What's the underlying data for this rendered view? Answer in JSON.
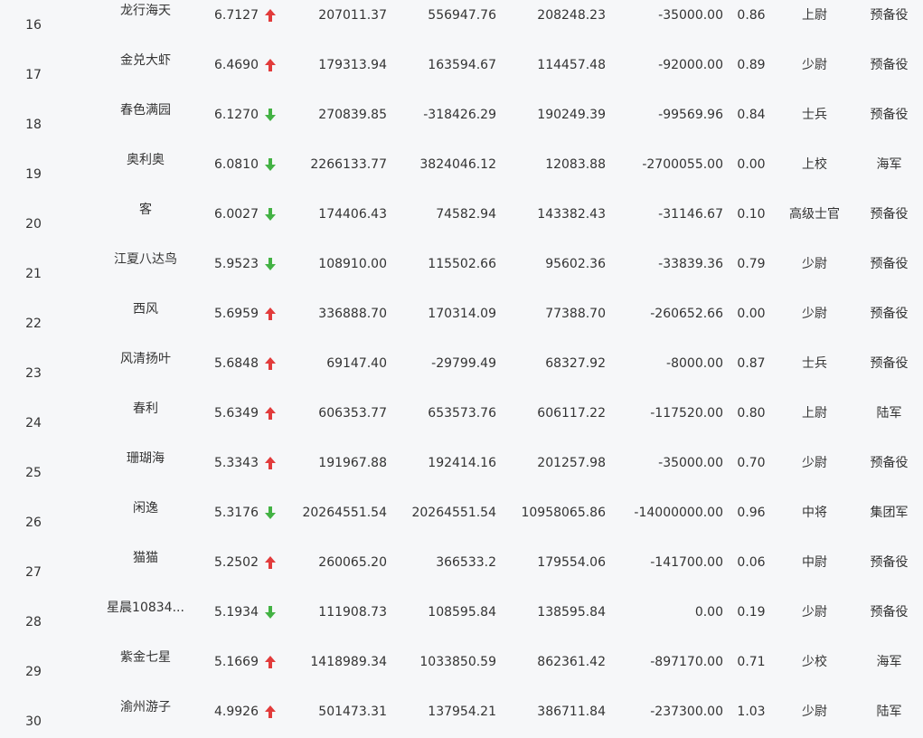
{
  "colors": {
    "up": "#e23b3b",
    "down": "#43b244",
    "background": "#f6f7f9",
    "text": "#333333"
  },
  "rows": [
    {
      "rank": "16",
      "name": "龙行海天",
      "score": "6.7127",
      "trend": "up",
      "v1": "207011.37",
      "v2": "556947.76",
      "v3": "208248.23",
      "v4": "-35000.00",
      "v5": "0.86",
      "title": "上尉",
      "branch": "预备役"
    },
    {
      "rank": "17",
      "name": "金兑大虾",
      "score": "6.4690",
      "trend": "up",
      "v1": "179313.94",
      "v2": "163594.67",
      "v3": "114457.48",
      "v4": "-92000.00",
      "v5": "0.89",
      "title": "少尉",
      "branch": "预备役"
    },
    {
      "rank": "18",
      "name": "春色满园",
      "score": "6.1270",
      "trend": "down",
      "v1": "270839.85",
      "v2": "-318426.29",
      "v3": "190249.39",
      "v4": "-99569.96",
      "v5": "0.84",
      "title": "士兵",
      "branch": "预备役"
    },
    {
      "rank": "19",
      "name": "奥利奥",
      "score": "6.0810",
      "trend": "down",
      "v1": "2266133.77",
      "v2": "3824046.12",
      "v3": "12083.88",
      "v4": "-2700055.00",
      "v5": "0.00",
      "title": "上校",
      "branch": "海军"
    },
    {
      "rank": "20",
      "name": "客",
      "score": "6.0027",
      "trend": "down",
      "v1": "174406.43",
      "v2": "74582.94",
      "v3": "143382.43",
      "v4": "-31146.67",
      "v5": "0.10",
      "title": "高级士官",
      "branch": "预备役"
    },
    {
      "rank": "21",
      "name": "江夏八达鸟",
      "score": "5.9523",
      "trend": "down",
      "v1": "108910.00",
      "v2": "115502.66",
      "v3": "95602.36",
      "v4": "-33839.36",
      "v5": "0.79",
      "title": "少尉",
      "branch": "预备役"
    },
    {
      "rank": "22",
      "name": "西风",
      "score": "5.6959",
      "trend": "up",
      "v1": "336888.70",
      "v2": "170314.09",
      "v3": "77388.70",
      "v4": "-260652.66",
      "v5": "0.00",
      "title": "少尉",
      "branch": "预备役"
    },
    {
      "rank": "23",
      "name": "风清扬叶",
      "score": "5.6848",
      "trend": "up",
      "v1": "69147.40",
      "v2": "-29799.49",
      "v3": "68327.92",
      "v4": "-8000.00",
      "v5": "0.87",
      "title": "士兵",
      "branch": "预备役"
    },
    {
      "rank": "24",
      "name": "春利",
      "score": "5.6349",
      "trend": "up",
      "v1": "606353.77",
      "v2": "653573.76",
      "v3": "606117.22",
      "v4": "-117520.00",
      "v5": "0.80",
      "title": "上尉",
      "branch": "陆军"
    },
    {
      "rank": "25",
      "name": "珊瑚海",
      "score": "5.3343",
      "trend": "up",
      "v1": "191967.88",
      "v2": "192414.16",
      "v3": "201257.98",
      "v4": "-35000.00",
      "v5": "0.70",
      "title": "少尉",
      "branch": "预备役"
    },
    {
      "rank": "26",
      "name": "闲逸",
      "score": "5.3176",
      "trend": "down",
      "v1": "20264551.54",
      "v2": "20264551.54",
      "v3": "10958065.86",
      "v4": "-14000000.00",
      "v5": "0.96",
      "title": "中将",
      "branch": "集团军"
    },
    {
      "rank": "27",
      "name": "猫猫",
      "score": "5.2502",
      "trend": "up",
      "v1": "260065.20",
      "v2": "366533.2",
      "v3": "179554.06",
      "v4": "-141700.00",
      "v5": "0.06",
      "title": "中尉",
      "branch": "预备役"
    },
    {
      "rank": "28",
      "name": "星晨10834...",
      "score": "5.1934",
      "trend": "down",
      "v1": "111908.73",
      "v2": "108595.84",
      "v3": "138595.84",
      "v4": "0.00",
      "v5": "0.19",
      "title": "少尉",
      "branch": "预备役"
    },
    {
      "rank": "29",
      "name": "紫金七星",
      "score": "5.1669",
      "trend": "up",
      "v1": "1418989.34",
      "v2": "1033850.59",
      "v3": "862361.42",
      "v4": "-897170.00",
      "v5": "0.71",
      "title": "少校",
      "branch": "海军"
    },
    {
      "rank": "30",
      "name": "渝州游子",
      "score": "4.9926",
      "trend": "up",
      "v1": "501473.31",
      "v2": "137954.21",
      "v3": "386711.84",
      "v4": "-237300.00",
      "v5": "1.03",
      "title": "少尉",
      "branch": "陆军"
    }
  ]
}
